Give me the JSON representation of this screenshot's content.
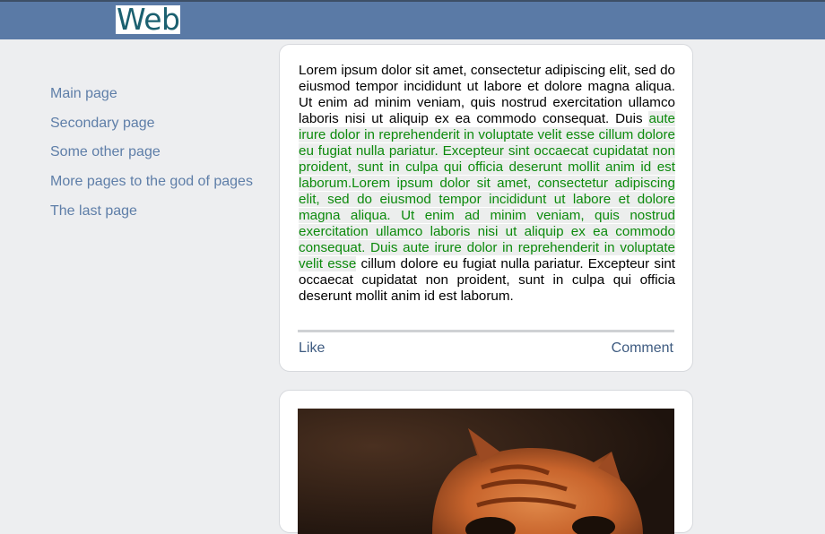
{
  "header": {
    "logo_text": "Web"
  },
  "sidebar": {
    "items": [
      {
        "label": "Main page"
      },
      {
        "label": "Secondary page"
      },
      {
        "label": "Some other page"
      },
      {
        "label": "More pages to the god of pages"
      },
      {
        "label": "The last page"
      }
    ]
  },
  "posts": [
    {
      "text_before": "Lorem ipsum dolor sit amet, consectetur adipiscing elit, sed do eiusmod tempor incididunt ut labore et dolore magna aliqua. Ut enim ad minim veniam, quis nostrud exercitation ullamco laboris nisi ut aliquip ex ea commodo consequat. Duis ",
      "text_selected": "aute irure dolor in reprehenderit in voluptate velit esse cillum dolore eu fugiat nulla pariatur. Excepteur sint occaecat cupidatat non proident, sunt in culpa qui officia deserunt mollit anim id est laborum.Lorem ipsum dolor sit amet, consectetur adipiscing elit, sed do eiusmod tempor incididunt ut labore et dolore magna aliqua. Ut enim ad minim veniam, quis nostrud exercitation ullamco laboris nisi ut aliquip ex ea commodo consequat. Duis aute irure dolor in reprehenderit in voluptate velit esse",
      "text_after": " cillum dolore eu fugiat nulla pariatur. Excepteur sint occaecat cupidatat non proident, sunt in culpa qui officia deserunt mollit anim id est laborum.",
      "like_label": "Like",
      "comment_label": "Comment"
    },
    {
      "image": "cat-photo"
    }
  ],
  "colors": {
    "topbar": "#5a7aa6",
    "link": "#5e7ea8",
    "selection_text": "#0c8a0c",
    "action": "#3e5b80"
  }
}
